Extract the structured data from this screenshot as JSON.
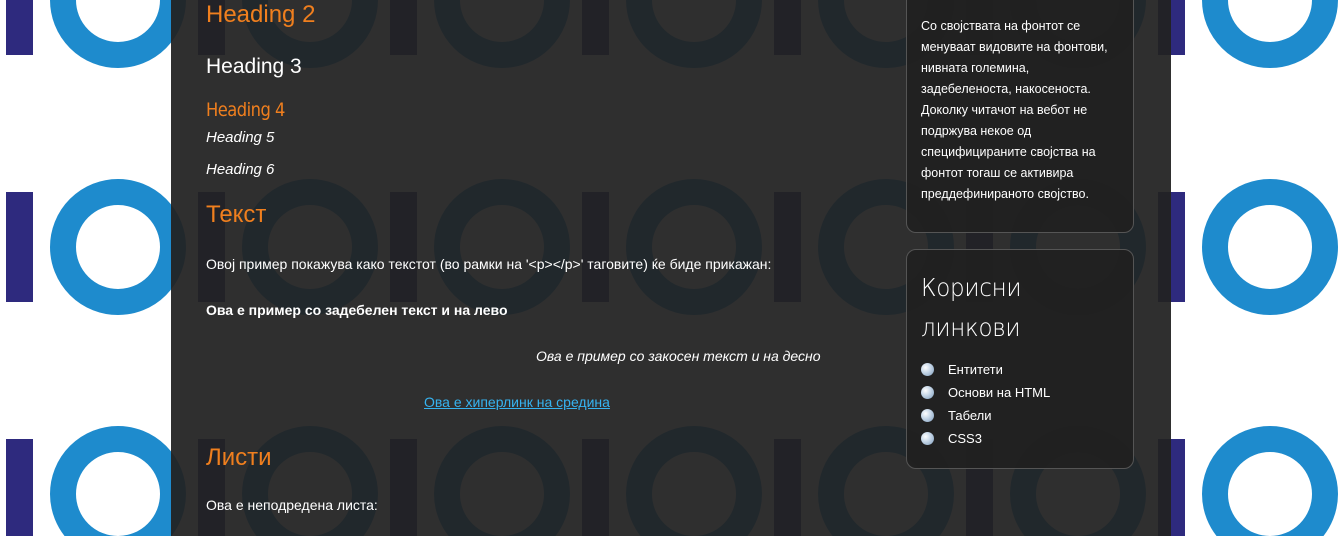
{
  "colors": {
    "accent": "#f07f1e",
    "link": "#36b3f0",
    "content_bg": "#222222",
    "ring_blue": "#1e8bcd",
    "bar_navy": "#2e2a7e"
  },
  "main": {
    "heading2": "Heading 2",
    "heading3": "Heading 3",
    "heading4": "Heading 4",
    "heading5": "Heading 5",
    "heading6": "Heading 6",
    "text_section_title": "Текст",
    "text_intro": "Овој пример покажува како текстот (во рамки на '<p></p>' таговите) ќе биде прикажан:",
    "bold_left": "Ова е пример со задебелен текст и на лево",
    "italic_right": "Ова е пример со закосен текст и на десно",
    "center_link": "Ова е хиперлинк на средина",
    "lists_section_title": "Листи",
    "unordered_intro": "Ова е неподредена листа:"
  },
  "sidebar": {
    "font_info_text": "Со својствата на фонтот се менуваат видовите на фонтови, нивната големина, задебеленоста, накосеноста. Доколку читачот на вебот не подржува некое од специфицираните својства на фонтот тогаш се активира преддефинираното својство.",
    "links_title": "Корисни линкови",
    "links": [
      {
        "label": "Ентитети"
      },
      {
        "label": "Основи на HTML"
      },
      {
        "label": "Табели"
      },
      {
        "label": "CSS3"
      }
    ]
  }
}
